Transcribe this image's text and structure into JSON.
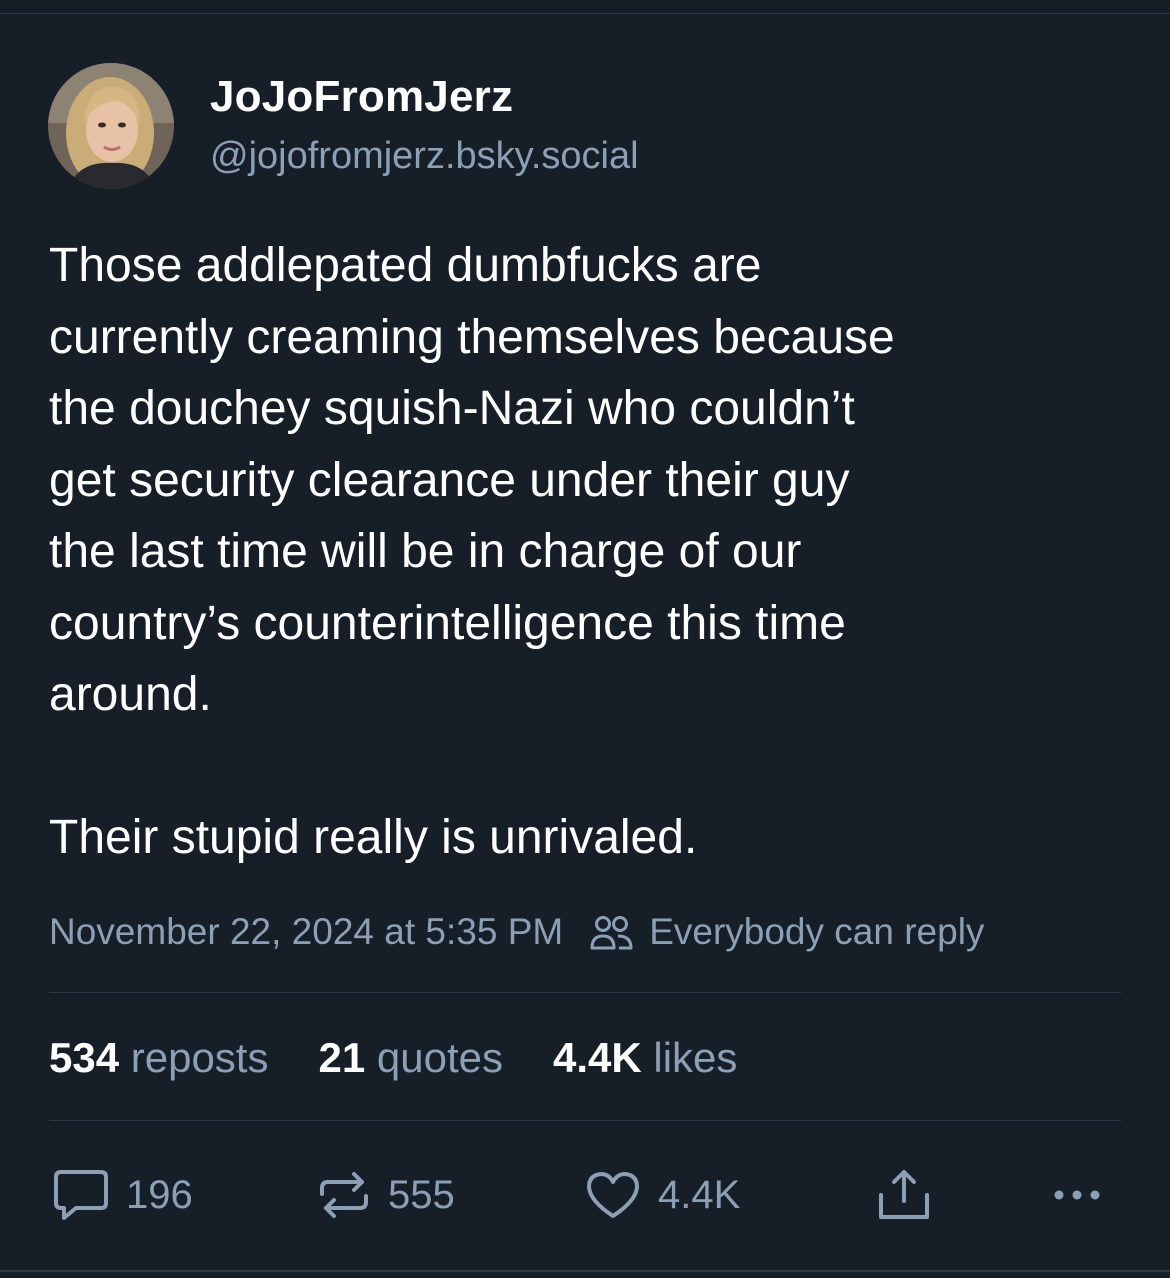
{
  "author": {
    "display_name": "JoJoFromJerz",
    "handle": "@jojofromjerz.bsky.social"
  },
  "post": {
    "lines": [
      "Those addlepated dumbfucks are",
      "currently creaming themselves because",
      "the douchey squish-Nazi who couldn’t",
      "get security clearance under their guy",
      "the last time will be in charge of our",
      "country’s counterintelligence this time",
      "around."
    ],
    "closing_line": "Their stupid really is unrivaled.",
    "timestamp": "November 22, 2024 at 5:35 PM",
    "reply_setting": "Everybody can reply"
  },
  "stats": {
    "reposts_count": "534",
    "reposts_label": "reposts",
    "quotes_count": "21",
    "quotes_label": "quotes",
    "likes_count": "4.4K",
    "likes_label": "likes"
  },
  "actions": {
    "reply_count": "196",
    "repost_count": "555",
    "like_count": "4.4K"
  },
  "icons": {
    "reply": "speech-bubble-icon",
    "repost": "repost-arrows-icon",
    "like": "heart-icon",
    "share": "share-upload-icon",
    "more": "ellipsis-icon",
    "reply_setting": "people-icon"
  },
  "colors": {
    "background": "#161e27",
    "text_primary": "#ffffff",
    "text_secondary": "#8c9fb5",
    "divider": "#2e3a48"
  }
}
